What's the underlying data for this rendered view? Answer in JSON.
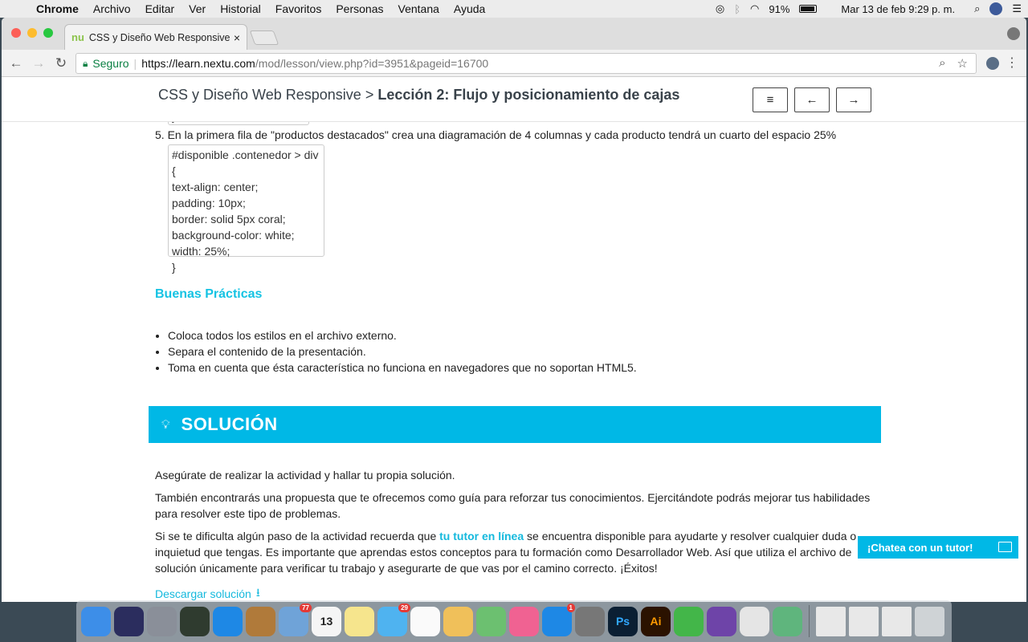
{
  "menubar": {
    "app": "Chrome",
    "items": [
      "Archivo",
      "Editar",
      "Ver",
      "Historial",
      "Favoritos",
      "Personas",
      "Ventana",
      "Ayuda"
    ],
    "battery": "91%",
    "datetime": "Mar 13 de feb  9:29 p. m."
  },
  "browser": {
    "tab_title": "CSS y Diseño Web Responsive",
    "tab_favicon": "nu",
    "security_label": "Seguro",
    "url_scheme_host": "https://learn.nextu.com",
    "url_path": "/mod/lesson/view.php?id=3951&pageid=16700"
  },
  "lesson_header": {
    "course": "CSS y Diseño Web Responsive",
    "separator": ">",
    "lesson": "Lección 2: Flujo y posicionamiento de cajas",
    "menu_label": "≡",
    "prev_label": "←",
    "next_label": "→"
  },
  "content": {
    "prev_code_tail": "}",
    "step5_number": "5.",
    "step5_text": "En la primera fila de \"productos destacados\" crea una diagramación de 4 columnas y cada producto tendrá un cuarto del espacio 25%",
    "code_lines": [
      "#disponible .contenedor > div {",
      "text-align: center;",
      "padding: 10px;",
      "border: solid 5px coral;",
      "background-color: white;",
      "width: 25%;",
      "}"
    ],
    "buenas_title": "Buenas Prácticas",
    "bullets": [
      "Coloca todos los estilos en el archivo externo.",
      "Separa el contenido de la presentación.",
      "Toma en cuenta que ésta característica no funciona en navegadores que no soportan HTML5."
    ],
    "solucion_title": "SOLUCIÓN",
    "p1": "Asegúrate de realizar la actividad y hallar tu propia solución.",
    "p2": "También encontrarás una propuesta que te ofrecemos como guía para reforzar tus conocimientos. Ejercitándote podrás mejorar tus habilidades para resolver este tipo de problemas.",
    "p3_before": "Si se te dificulta algún paso de la actividad recuerda que ",
    "p3_link": "tu tutor en línea",
    "p3_after": " se encuentra disponible para ayudarte y resolver cualquier duda o inquietud que tengas. Es importante que aprendas estos conceptos para tu formación como Desarrollador Web. Así que utiliza el archivo de solución únicamente para verificar tu trabajo y asegurarte de que vas por el camino correcto. ¡Éxitos!",
    "download_label": "Descargar solución",
    "chat_label": "¡Chatea con un tutor!"
  },
  "dock": {
    "apps": [
      {
        "name": "finder",
        "label": "",
        "color": "#3d8ee8"
      },
      {
        "name": "siri",
        "label": "",
        "color": "#2b2d5e"
      },
      {
        "name": "launchpad",
        "label": "",
        "color": "#8a8f99"
      },
      {
        "name": "mission-control",
        "label": "",
        "color": "#2f3b2f"
      },
      {
        "name": "safari",
        "label": "",
        "color": "#1e88e5"
      },
      {
        "name": "notes-brown",
        "label": "",
        "color": "#b07a3a"
      },
      {
        "name": "mail",
        "label": "",
        "color": "#6fa3d8",
        "badge": "77"
      },
      {
        "name": "calendar",
        "label": "13",
        "color": "#f5f5f5",
        "text": "#222"
      },
      {
        "name": "notes",
        "label": "",
        "color": "#f6e58d"
      },
      {
        "name": "messages",
        "label": "",
        "color": "#4fb3f0",
        "badge": "29"
      },
      {
        "name": "reminders",
        "label": "",
        "color": "#fafafa"
      },
      {
        "name": "photos",
        "label": "",
        "color": "#f0c05a"
      },
      {
        "name": "maps",
        "label": "",
        "color": "#6cc070"
      },
      {
        "name": "music",
        "label": "",
        "color": "#f06292"
      },
      {
        "name": "app-store",
        "label": "",
        "color": "#1e88e5",
        "badge": "1"
      },
      {
        "name": "system-preferences",
        "label": "",
        "color": "#777"
      },
      {
        "name": "photoshop",
        "label": "Ps",
        "color": "#0b1f33",
        "text": "#31a8ff"
      },
      {
        "name": "illustrator",
        "label": "Ai",
        "color": "#2b1200",
        "text": "#ff9a00"
      },
      {
        "name": "facetime",
        "label": "",
        "color": "#43b649"
      },
      {
        "name": "github",
        "label": "",
        "color": "#6e44a8"
      },
      {
        "name": "chrome",
        "label": "",
        "color": "#e5e5e5"
      },
      {
        "name": "atom",
        "label": "",
        "color": "#5fb57d"
      }
    ]
  }
}
